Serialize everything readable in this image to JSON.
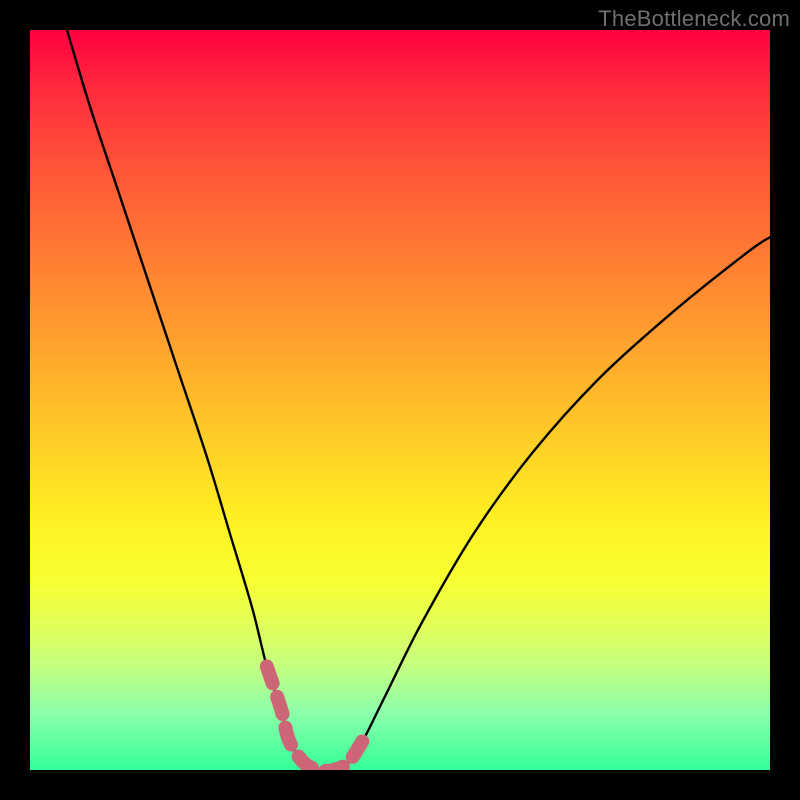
{
  "watermark": "TheBottleneck.com",
  "chart_data": {
    "type": "line",
    "title": "",
    "xlabel": "",
    "ylabel": "",
    "xlim": [
      0,
      100
    ],
    "ylim": [
      0,
      100
    ],
    "grid": false,
    "series": [
      {
        "name": "bottleneck-curve",
        "x": [
          5,
          8,
          12,
          16,
          20,
          24,
          27,
          30,
          32,
          34,
          35,
          37,
          39,
          41,
          43,
          45,
          48,
          53,
          60,
          68,
          77,
          87,
          97,
          100
        ],
        "y": [
          100,
          90,
          78,
          66,
          54,
          42,
          32,
          22,
          14,
          8,
          4,
          1,
          0,
          0,
          1,
          4,
          10,
          20,
          32,
          43,
          53,
          62,
          70,
          72
        ]
      },
      {
        "name": "highlight-segment",
        "x": [
          32,
          34,
          35,
          37,
          39,
          41,
          43,
          45
        ],
        "y": [
          14,
          8,
          4,
          1,
          0,
          0,
          1,
          4
        ]
      }
    ],
    "colors": {
      "curve": "#000000",
      "highlight": "#cc6677",
      "gradient_top": "#ff0040",
      "gradient_bottom": "#33ff99"
    }
  }
}
